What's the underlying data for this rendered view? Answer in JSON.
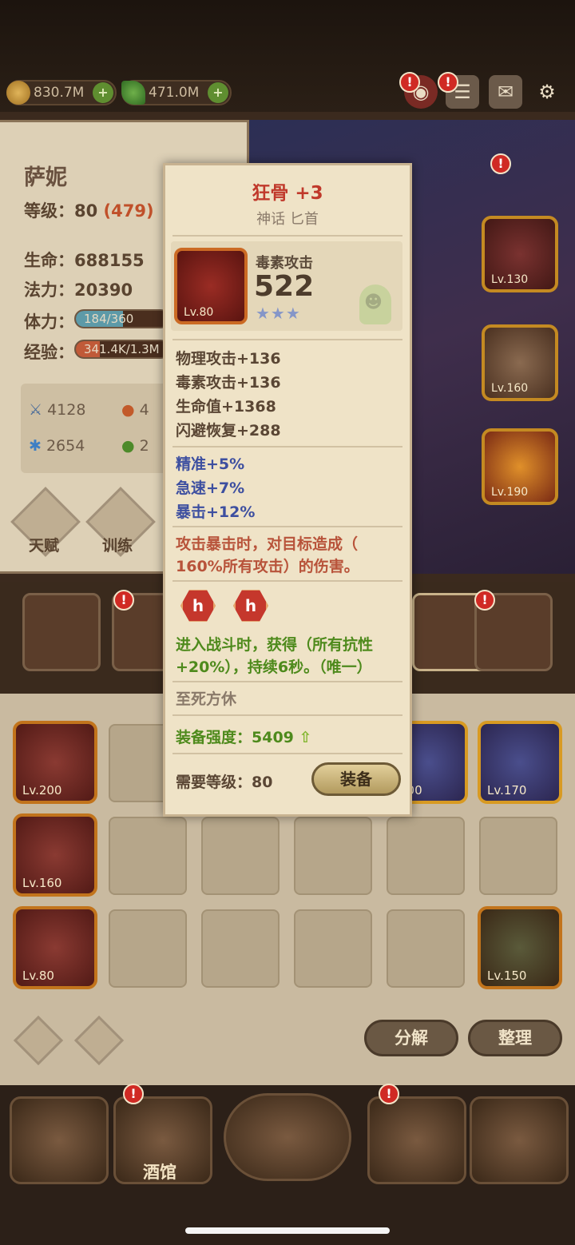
{
  "currency": {
    "gold": "830.7M",
    "gem": "471.0M"
  },
  "hero": {
    "name": "萨妮",
    "level_label": "等级：",
    "level": "80",
    "level_extra": "(479)",
    "hp_label": "生命：",
    "hp": "688155",
    "mp_label": "法力：",
    "mp": "20390",
    "stamina_label": "体力：",
    "stamina": "184/360",
    "stamina_fill": 0.51,
    "exp_label": "经验：",
    "exp": "341.4K/1.3M",
    "exp_fill": 0.26,
    "attack": "4128",
    "stat_fire_partial": "4",
    "defense": "2654",
    "stat_poison_partial": "2"
  },
  "hero_buttons": {
    "talent": "天赋",
    "train": "训练"
  },
  "hero_slots": [
    {
      "level": "Lv.130"
    },
    {
      "level": "Lv.160"
    },
    {
      "level": "Lv.190"
    }
  ],
  "popup": {
    "name": "狂骨 +3",
    "type": "神话 匕首",
    "icon_level": "Lv.80",
    "main_stat_name": "毒素攻击",
    "main_stat_value": "522",
    "stars": "★★★",
    "base_stats": [
      "物理攻击+136",
      "毒素攻击+136",
      "生命值+1368",
      "闪避恢复+288"
    ],
    "bonus_stats": [
      "精准+5%",
      "急速+7%",
      "暴击+12%"
    ],
    "effect_1": "攻击暴击时，对目标造成（",
    "effect_2": "160%所有攻击）的伤害。",
    "gem_glyph": "h",
    "set_effect_1": "进入战斗时，获得（所有抗性",
    "set_effect_2": "+20%），持续6秒。（唯一）",
    "flavor": "至死方休",
    "power_label": "装备强度：",
    "power_value": "5409",
    "req_label": "需要等级：",
    "req_value": "80",
    "equip_button": "装备"
  },
  "inventory": [
    {
      "level": "Lv.200"
    },
    {
      "level": "Lv.160"
    },
    {
      "level": "Lv.80"
    },
    {
      "level": "200"
    },
    {
      "level": "Lv.170"
    },
    {
      "level": "Lv.150"
    }
  ],
  "inventory_buttons": {
    "decompose": "分解",
    "organize": "整理"
  },
  "nav": {
    "tavern": "酒馆"
  },
  "alert_glyph": "!",
  "icons": {
    "gold": "coin-icon",
    "gem": "leaf-gem-icon",
    "chat": "chat-icon",
    "mail": "mail-icon",
    "settings": "gear-icon",
    "power_up": "arrow-up-icon"
  },
  "colors": {
    "rarity_mythic_title": "#c0392b",
    "bonus_stat": "#3d4fa0",
    "effect_text": "#b8533a",
    "set_text": "#4e8a1c"
  }
}
